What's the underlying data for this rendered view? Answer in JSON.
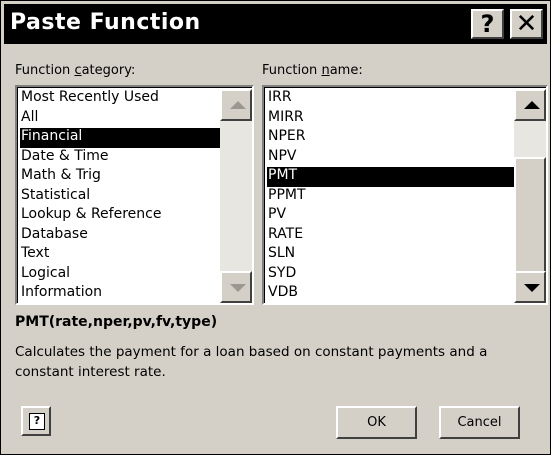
{
  "dialog": {
    "title": "Paste Function",
    "help_glyph": "?",
    "close_glyph": "✕"
  },
  "category": {
    "label_pre": "Function ",
    "label_accel": "c",
    "label_post": "ategory:",
    "items": [
      {
        "label": "Most Recently Used",
        "selected": false
      },
      {
        "label": "All",
        "selected": false
      },
      {
        "label": "Financial",
        "selected": true
      },
      {
        "label": "Date & Time",
        "selected": false
      },
      {
        "label": "Math & Trig",
        "selected": false
      },
      {
        "label": "Statistical",
        "selected": false
      },
      {
        "label": "Lookup & Reference",
        "selected": false
      },
      {
        "label": "Database",
        "selected": false
      },
      {
        "label": "Text",
        "selected": false
      },
      {
        "label": "Logical",
        "selected": false
      },
      {
        "label": "Information",
        "selected": false
      }
    ]
  },
  "function": {
    "label_pre": "Function ",
    "label_accel": "n",
    "label_post": "ame:",
    "items": [
      {
        "label": "IRR",
        "selected": false
      },
      {
        "label": "MIRR",
        "selected": false
      },
      {
        "label": "NPER",
        "selected": false
      },
      {
        "label": "NPV",
        "selected": false
      },
      {
        "label": "PMT",
        "selected": true
      },
      {
        "label": "PPMT",
        "selected": false
      },
      {
        "label": "PV",
        "selected": false
      },
      {
        "label": "RATE",
        "selected": false
      },
      {
        "label": "SLN",
        "selected": false
      },
      {
        "label": "SYD",
        "selected": false
      },
      {
        "label": "VDB",
        "selected": false
      }
    ]
  },
  "syntax": "PMT(rate,nper,pv,fv,type)",
  "description": "Calculates the payment for a loan based on constant payments and a constant interest rate.",
  "buttons": {
    "ok": "OK",
    "cancel": "Cancel",
    "office_assistant_glyph": "?"
  },
  "icons": {
    "help": "question-mark-icon",
    "close": "close-icon",
    "scroll_up": "arrow-up-icon",
    "scroll_down": "arrow-down-icon",
    "assistant": "office-assistant-icon"
  },
  "colors": {
    "face": "#d4d0c8",
    "selection": "#000000",
    "titlebar": "#000000"
  }
}
